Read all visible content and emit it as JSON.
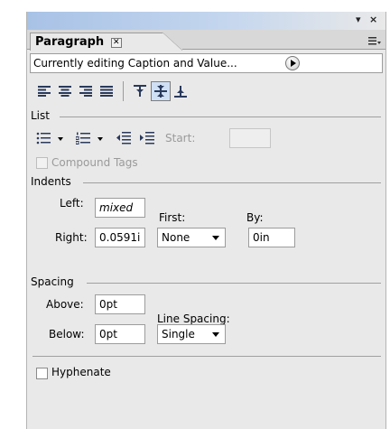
{
  "panel": {
    "tab_label": "Paragraph",
    "editing_label": "Currently editing Caption and Value...",
    "list_section": "List",
    "start_label": "Start:",
    "start_value": "",
    "compound_tags_label": "Compound Tags",
    "indents_section": "Indents",
    "left_label": "Left:",
    "left_value": "mixed",
    "first_label": "First:",
    "by_label": "By:",
    "right_label": "Right:",
    "right_value": "0.0591i",
    "first_value": "None",
    "by_value": "0in",
    "spacing_section": "Spacing",
    "above_label": "Above:",
    "above_value": "0pt",
    "line_spacing_label": "Line Spacing:",
    "below_label": "Below:",
    "below_value": "0pt",
    "line_spacing_value": "Single",
    "hyphenate_label": "Hyphenate"
  },
  "window_buttons": {
    "menu": "▾",
    "close": "×"
  },
  "icons": [
    "align-left-icon",
    "align-center-icon",
    "align-right-icon",
    "justify-icon",
    "align-top-icon",
    "align-middle-icon",
    "align-bottom-icon",
    "bullet-list-icon",
    "numbered-list-icon",
    "decrease-indent-icon",
    "increase-indent-icon"
  ],
  "state": {
    "selected_vertical_alignment": "align-middle",
    "compound_tags_checked": false,
    "hyphenate_checked": false
  },
  "colors": {
    "panel_bg": "#e9e9e9",
    "titlebar_blue": "#a8c2e6",
    "selected_button": "#cfe0f5"
  }
}
